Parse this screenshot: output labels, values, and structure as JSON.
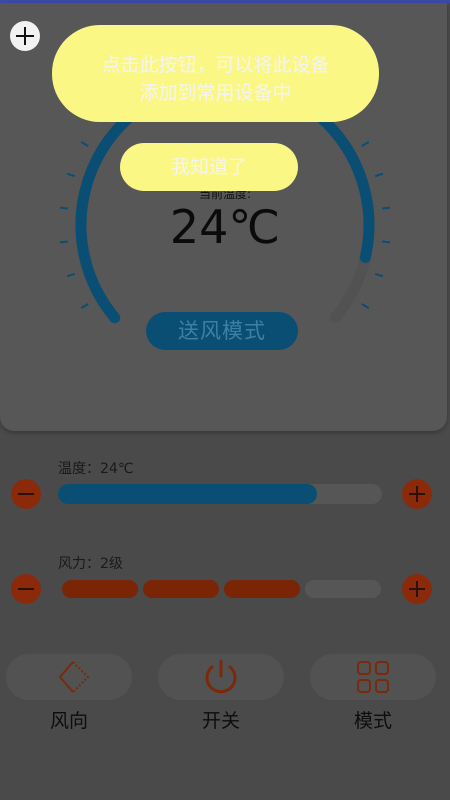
{
  "climate": {
    "current_label": "当前温度:",
    "temperature": "24℃",
    "mode_button": "送风模式"
  },
  "temperature_control": {
    "label": "温度：24℃",
    "level": 0.8
  },
  "fan_control": {
    "label": "风力：2级",
    "active_segments": 3,
    "total_segments": 4
  },
  "bottom_bar": {
    "direction_label": "风向",
    "power_label": "开关",
    "mode_label": "模式"
  },
  "guide_overlay": {
    "line1": "点击此按钮，可以将此设备",
    "line2": "添加到常用设备中",
    "dismiss_label": "我知道了"
  },
  "colors": {
    "accent_blue": "#0b4e73",
    "accent_orange": "#8a2a0a",
    "tooltip_yellow": "#fbf785"
  },
  "icons": [
    "add-circle-icon",
    "minus-icon",
    "plus-icon",
    "wind-direction-icon",
    "power-icon",
    "grid-icon"
  ]
}
